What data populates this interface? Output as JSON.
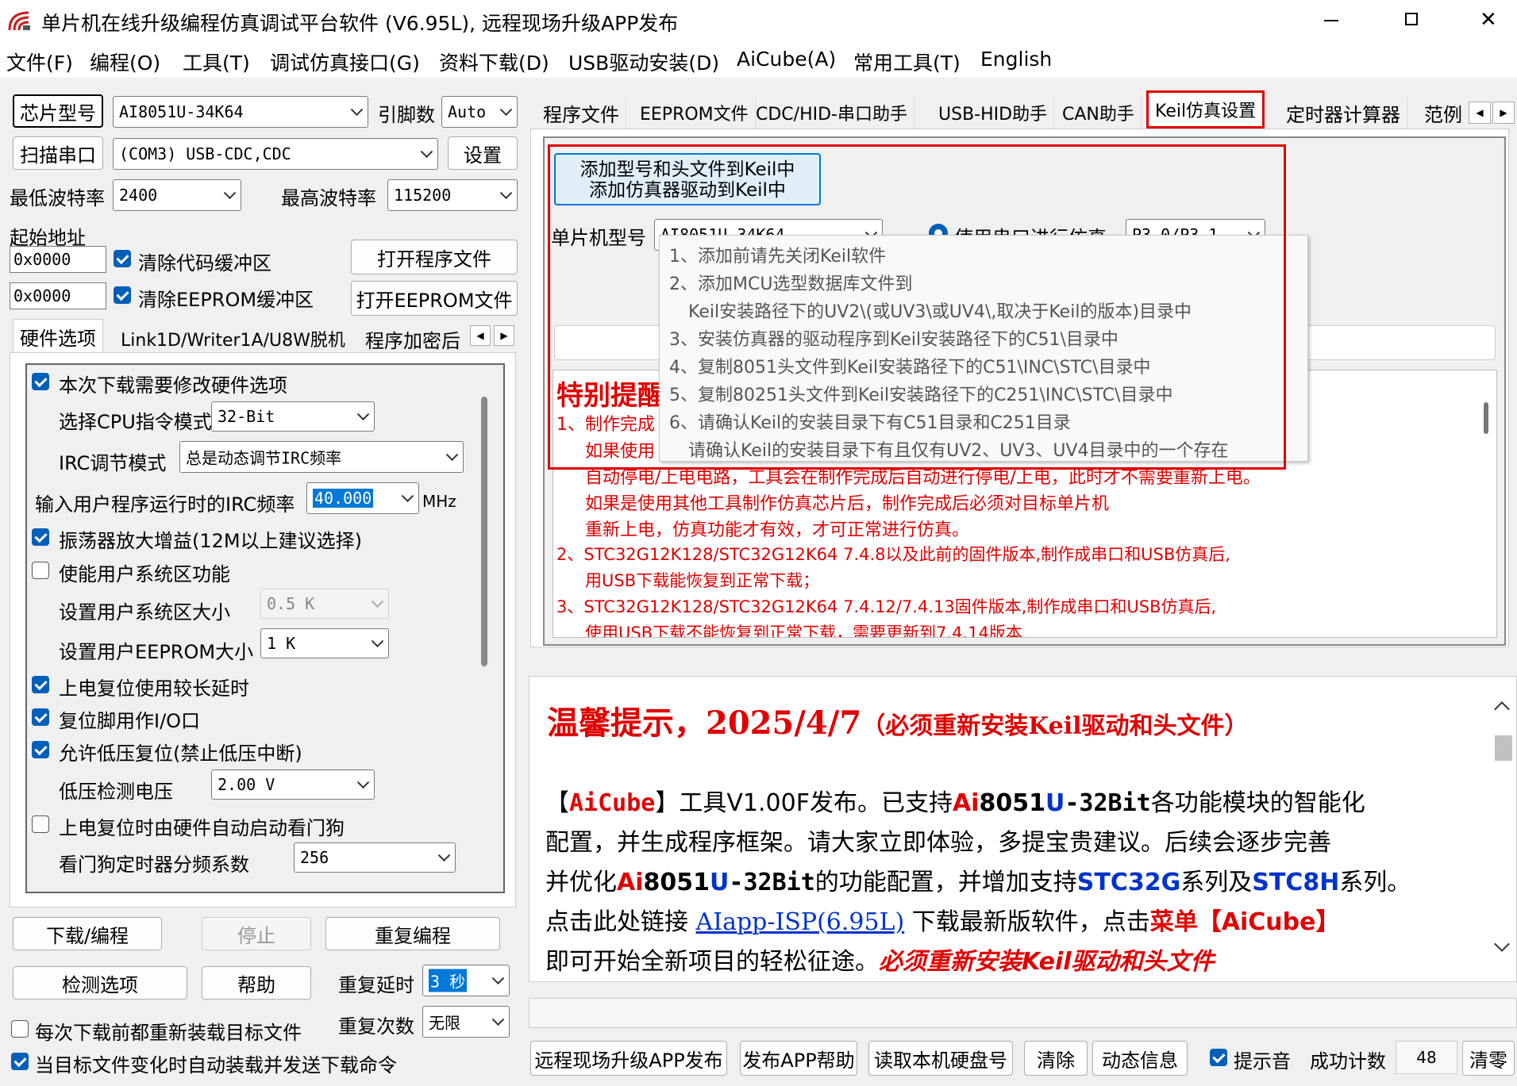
{
  "window": {
    "title": "单片机在线升级编程仿真调试平台软件 (V6.95L), 远程现场升级APP发布"
  },
  "menu": [
    "文件(F)",
    "编程(O)",
    "工具(T)",
    "调试仿真接口(G)",
    "资料下载(D)",
    "USB驱动安装(D)",
    "AiCube(A)",
    "常用工具(T)",
    "English"
  ],
  "left": {
    "chip_btn": "芯片型号",
    "chip_value": "AI8051U-34K64",
    "pin_label": "引脚数",
    "pin_value": "Auto",
    "scan_btn": "扫描串口",
    "port_value": "(COM3) USB-CDC,CDC",
    "settings_btn": "设置",
    "min_baud_label": "最低波特率",
    "min_baud": "2400",
    "max_baud_label": "最高波特率",
    "max_baud": "115200",
    "start_addr_label": "起始地址",
    "addr1": "0x0000",
    "clear_code": "清除代码缓冲区",
    "open_prog": "打开程序文件",
    "addr2": "0x0000",
    "clear_eeprom": "清除EEPROM缓冲区",
    "open_eeprom": "打开EEPROM文件",
    "tabs": [
      "硬件选项",
      "Link1D/Writer1A/U8W脱机",
      "程序加密后"
    ],
    "hw": {
      "modify": "本次下载需要修改硬件选项",
      "cpu_mode_label": "选择CPU指令模式",
      "cpu_mode": "32-Bit",
      "irc_mode_label": "IRC调节模式",
      "irc_mode": "总是动态调节IRC频率",
      "irc_freq_label": "输入用户程序运行时的IRC频率",
      "irc_freq": "40.000",
      "mhz": "MHz",
      "osc_gain": "振荡器放大增益(12M以上建议选择)",
      "user_sys": "使能用户系统区功能",
      "sys_size_label": "设置用户系统区大小",
      "sys_size": "0.5 K",
      "eeprom_size_label": "设置用户EEPROM大小",
      "eeprom_size": "1   K",
      "long_delay": "上电复位使用较长延时",
      "reset_io": "复位脚用作I/O口",
      "lvr": "允许低压复位(禁止低压中断)",
      "lvd_label": "低压检测电压",
      "lvd": "2.00 V",
      "wdt": "上电复位时由硬件自动启动看门狗",
      "wdt_div_label": "看门狗定时器分频系数",
      "wdt_div": "256"
    },
    "download_btn": "下载/编程",
    "stop_btn": "停止",
    "reprog_btn": "重复编程",
    "check_btn": "检测选项",
    "help_btn": "帮助",
    "repeat_delay_label": "重复延时",
    "repeat_delay": "3 秒",
    "reload": "每次下载前都重新装载目标文件",
    "repeat_count_label": "重复次数",
    "repeat_count": "无限",
    "auto_send": "当目标文件变化时自动装载并发送下载命令"
  },
  "right": {
    "tabs": [
      "程序文件",
      "EEPROM文件",
      "CDC/HID-串口助手",
      "USB-HID助手",
      "CAN助手",
      "Keil仿真设置",
      "定时器计算器",
      "范例"
    ],
    "keil": {
      "add_btn_l1": "添加型号和头文件到Keil中",
      "add_btn_l2": "添加仿真器驱动到Keil中",
      "mcu_label": "单片机型号",
      "mcu_value": "AI8051U-34K64",
      "serial_label": "使用串口进行仿真",
      "serial_value": "P3.0/P3.1",
      "notice_title": "特别提醒",
      "notice_lines": [
        "1、制作完成",
        "如果使用",
        "自动停电/上电电路，工具会在制作完成后自动进行停电/上电，此时才不需要重新上电。",
        "如果是使用其他工具制作仿真芯片后，制作完成后必须对目标单片机",
        "重新上电，仿真功能才有效，才可正常进行仿真。",
        "2、STC32G12K128/STC32G12K64   7.4.8以及此前的固件版本,制作成串口和USB仿真后,",
        "用USB下载能恢复到正常下载；",
        "3、STC32G12K128/STC32G12K64   7.4.12/7.4.13固件版本,制作成串口和USB仿真后,",
        "使用USB下载不能恢复到正常下载，需要更新到7.4.14版本"
      ],
      "tooltip": [
        "1、添加前请先关闭Keil软件",
        "2、添加MCU选型数据库文件到",
        "Keil安装路径下的UV2\\(或UV3\\或UV4\\,取决于Keil的版本)目录中",
        "3、安装仿真器的驱动程序到Keil安装路径下的C51\\目录中",
        "4、复制8051头文件到Keil安装路径下的C51\\INC\\STC\\目录中",
        "5、复制80251头文件到Keil安装路径下的C251\\INC\\STC\\目录中",
        "6、请确认Keil的安装目录下有C51目录和C251目录",
        "请确认Keil的安装目录下有且仅有UV2、UV3、UV4目录中的一个存在"
      ]
    },
    "news": {
      "heading": "温馨提示，2025/4/7",
      "heading_note": "（必须重新安装Keil驱动和头文件）",
      "p1a": "【",
      "aicube": "AiCube",
      "p1b": "】工具V1.00F发布。已支持",
      "ai": "Ai",
      "n8051": "8051",
      "u": "U",
      "bit32": "-32Bit",
      "p1c": "各功能模块的智能化",
      "p2": "配置，并生成程序框架。请大家立即体验，多提宝贵建议。后续会逐步完善",
      "p3a": "并优化",
      "p3b": "的功能配置，并增加支持",
      "stc32g": "STC32G",
      "p3c": "系列及",
      "stc8h": "STC8H",
      "p3d": "系列。",
      "p4a": "点击此处链接 ",
      "link": "AIapp-ISP(6.95L)",
      "p4b": " 下载最新版软件，点击",
      "menu_word": "菜单",
      "p4c": "【AiCube】",
      "p5a": "即可开始全新项目的轻松征途。",
      "p5b": "必须重新安装Keil驱动和头文件"
    },
    "bottom": {
      "publish": "远程现场升级APP发布",
      "app_help": "发布APP帮助",
      "read_disk": "读取本机硬盘号",
      "clear": "清除",
      "dyn_info": "动态信息",
      "beep": "提示音",
      "success_label": "成功计数",
      "success_count": "48",
      "reset": "清零"
    }
  }
}
